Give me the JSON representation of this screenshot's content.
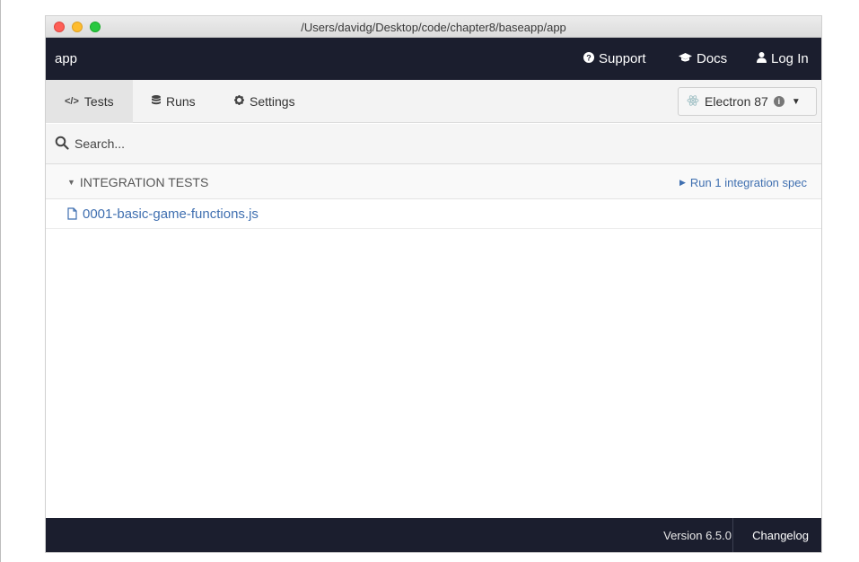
{
  "window": {
    "title": "/Users/davidg/Desktop/code/chapter8/baseapp/app"
  },
  "header": {
    "app_name": "app",
    "links": [
      {
        "label": "Support",
        "icon": "question-circle-icon"
      },
      {
        "label": "Docs",
        "icon": "graduation-cap-icon"
      },
      {
        "label": "Log In",
        "icon": "user-icon"
      }
    ]
  },
  "nav": {
    "tabs": [
      {
        "label": "Tests",
        "icon": "code-icon",
        "active": true
      },
      {
        "label": "Runs",
        "icon": "database-icon",
        "active": false
      },
      {
        "label": "Settings",
        "icon": "gear-icon",
        "active": false
      }
    ],
    "browser": {
      "label": "Electron 87",
      "icon": "electron-icon"
    }
  },
  "search": {
    "placeholder": "Search...",
    "value": ""
  },
  "specs": {
    "section_title": "INTEGRATION TESTS",
    "run_label": "Run 1 integration spec",
    "files": [
      {
        "name": "0001-basic-game-functions.js"
      }
    ]
  },
  "footer": {
    "version": "Version 6.5.0",
    "changelog": "Changelog"
  },
  "colors": {
    "header_bg": "#1b1e2e",
    "link_blue": "#3f6fb0",
    "traffic_red": "#fe5f57",
    "traffic_yellow": "#febc2e",
    "traffic_green": "#28c840"
  }
}
